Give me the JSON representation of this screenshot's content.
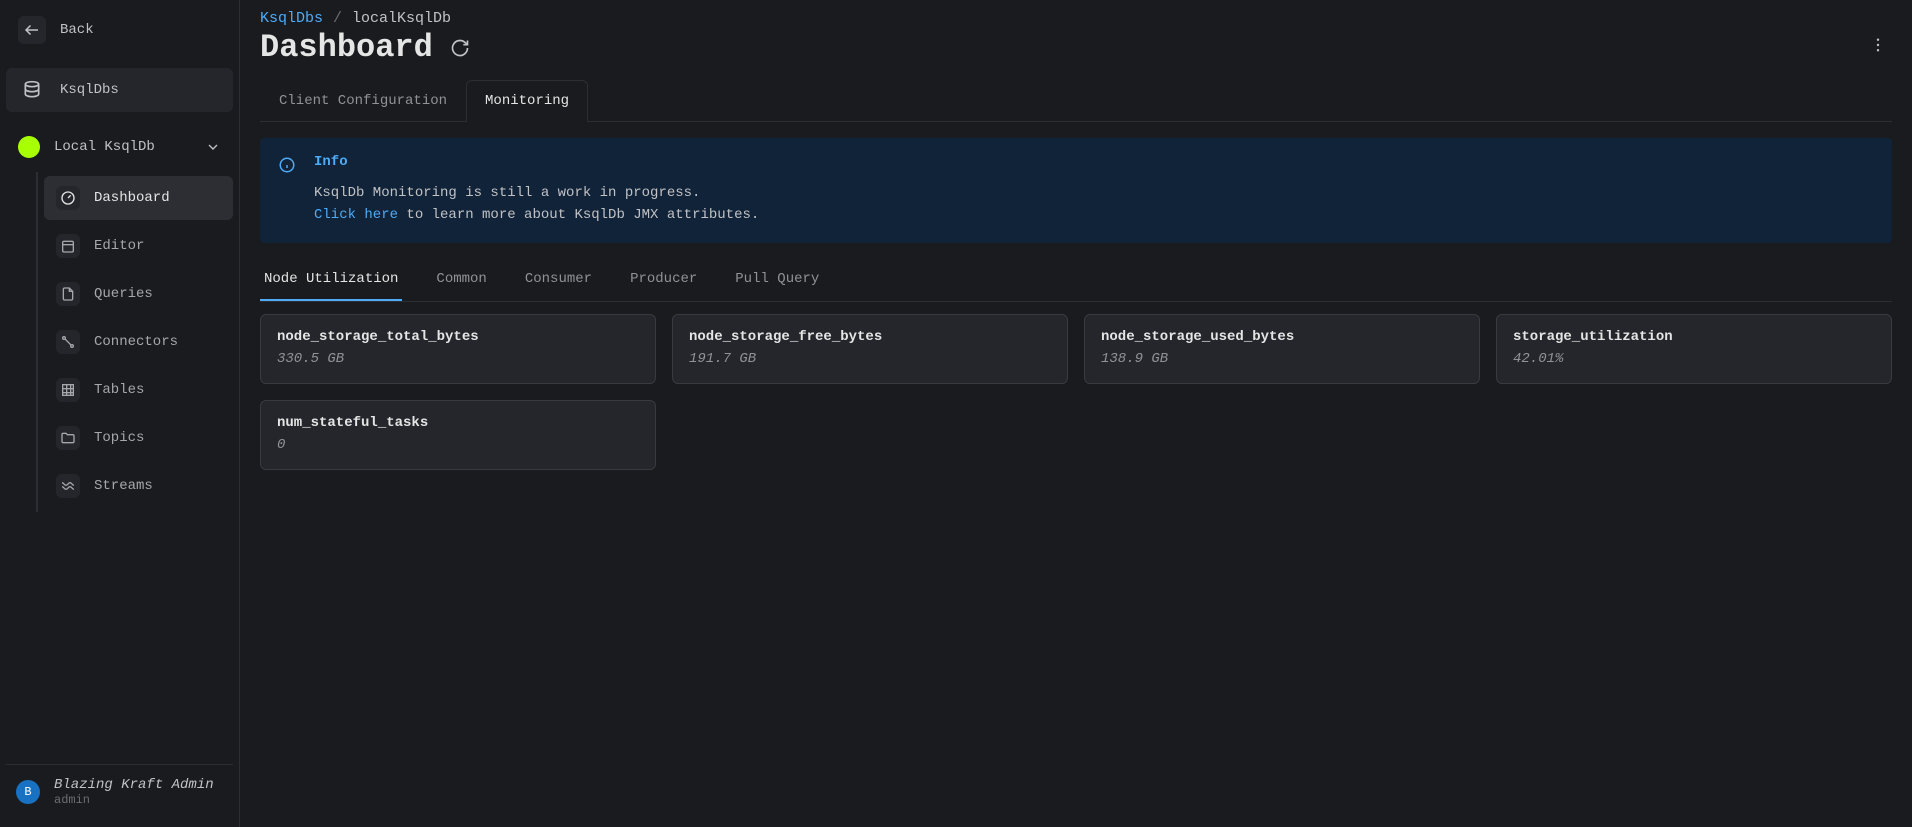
{
  "sidebar": {
    "back": "Back",
    "ksqlDbs": "KsqlDbs",
    "localKsqlDb": "Local KsqlDb",
    "items": [
      {
        "label": "Dashboard"
      },
      {
        "label": "Editor"
      },
      {
        "label": "Queries"
      },
      {
        "label": "Connectors"
      },
      {
        "label": "Tables"
      },
      {
        "label": "Topics"
      },
      {
        "label": "Streams"
      }
    ]
  },
  "user": {
    "name": "Blazing Kraft Admin",
    "role": "admin",
    "initial": "B"
  },
  "breadcrumb": {
    "root": "KsqlDbs",
    "current": "localKsqlDb"
  },
  "page": {
    "title": "Dashboard"
  },
  "outer_tabs": [
    {
      "label": "Client Configuration"
    },
    {
      "label": "Monitoring"
    }
  ],
  "info": {
    "title": "Info",
    "line1": "KsqlDb Monitoring is still a work in progress.",
    "link": "Click here",
    "line2_rest": " to learn more about KsqlDb JMX attributes."
  },
  "inner_tabs": [
    {
      "label": "Node Utilization"
    },
    {
      "label": "Common"
    },
    {
      "label": "Consumer"
    },
    {
      "label": "Producer"
    },
    {
      "label": "Pull Query"
    }
  ],
  "metrics": [
    {
      "name": "node_storage_total_bytes",
      "value": "330.5 GB"
    },
    {
      "name": "node_storage_free_bytes",
      "value": "191.7 GB"
    },
    {
      "name": "node_storage_used_bytes",
      "value": "138.9 GB"
    },
    {
      "name": "storage_utilization",
      "value": "42.01%"
    },
    {
      "name": "num_stateful_tasks",
      "value": "0"
    }
  ]
}
